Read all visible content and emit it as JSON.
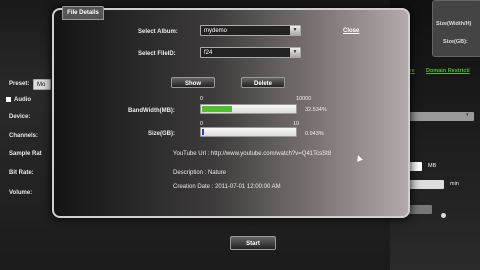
{
  "background": {
    "preset_label": "Preset:",
    "preset_value": "Mo",
    "audio_label": "Audio",
    "device_label": "Device:",
    "channels_label": "Channels:",
    "sample_rate_label": "Sample Rat",
    "bit_rate_label": "Bit Rate:",
    "volume_label": "Volume:",
    "right_size_label": "Size(Width/H)",
    "right_size_gb_label": "Size(GB):",
    "green_text_left": "ire",
    "green_text_right": "Domain Restricti",
    "mb_label": "MB",
    "min_label": "min",
    "start_button": "Start"
  },
  "modal": {
    "tab_title": "File Details",
    "album_label": "Select Album:",
    "album_value": "mydemo",
    "fileid_label": "Select FileID:",
    "fileid_value": "f24",
    "close_link": "Close",
    "show_button": "Show",
    "delete_button": "Delete",
    "bandwidth": {
      "label": "BandWidth(MB):",
      "min": "0",
      "max": "10000",
      "percent_text": "32.534%",
      "fraction": 0.32534
    },
    "size": {
      "label": "Size(GB):",
      "min": "0",
      "max": "10",
      "percent_text": "0.943%",
      "fraction": 0.00943
    },
    "youtube_url": "YouTube Url :  http://www.youtube.com/watch?v=Q41TcsSt8",
    "description": "Description :  Nature",
    "creation_date": "Creation Date :  2011-07-01 12:00:00 AM"
  },
  "colors": {
    "bandwidth_fill": "#4fc12f",
    "size_fill": "#2f3fc9"
  }
}
